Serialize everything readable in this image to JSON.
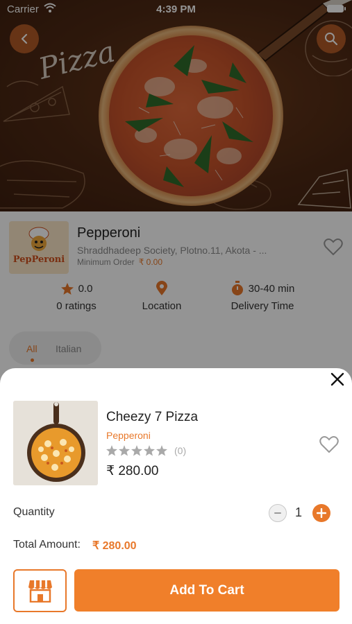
{
  "status_bar": {
    "carrier": "Carrier",
    "time": "4:39 PM"
  },
  "hero": {
    "script_text": "Pizza"
  },
  "restaurant": {
    "name": "Pepperoni",
    "logo_text": "PepPeroni",
    "address": "Shraddhadeep Society, Plotno.11, Akota - ...",
    "min_order_label": "Minimum Order",
    "min_order_value": "₹ 0.00",
    "rating_value": "0.0",
    "ratings_label": "0 ratings",
    "location_label": "Location",
    "delivery_value": "30-40 min",
    "delivery_label": "Delivery Time"
  },
  "tabs": [
    {
      "label": "All",
      "active": true
    },
    {
      "label": "Italian",
      "active": false
    }
  ],
  "product": {
    "name": "Cheezy 7 Pizza",
    "restaurant": "Pepperoni",
    "rating": 0,
    "rating_count": "(0)",
    "price": "₹ 280.00"
  },
  "quantity": {
    "label": "Quantity",
    "value": "1"
  },
  "total": {
    "label": "Total Amount:",
    "value": "₹ 280.00"
  },
  "actions": {
    "add_to_cart": "Add To Cart"
  },
  "icons": {
    "back": "back-chevron-icon",
    "search": "search-icon",
    "favorite": "heart-outline-icon",
    "star": "star-icon",
    "location": "location-pin-icon",
    "timer": "stopwatch-icon",
    "close": "close-icon",
    "store": "storefront-icon"
  },
  "colors": {
    "accent": "#e8782a",
    "hero_bg": "#4e2914",
    "button": "#f07f2a"
  }
}
